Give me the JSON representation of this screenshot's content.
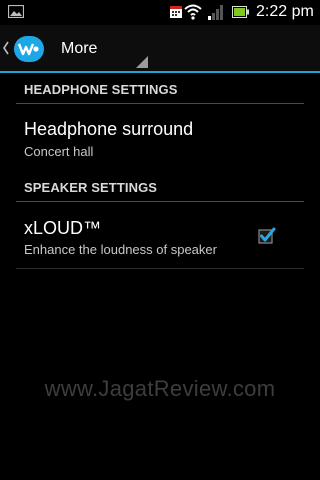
{
  "status_bar": {
    "time": "2:22 pm",
    "icons": [
      "gallery-icon",
      "calendar-notification-icon",
      "wifi-icon",
      "signal-icon",
      "battery-icon"
    ]
  },
  "action_bar": {
    "title": "More",
    "logo": "walkman-icon",
    "accent_color": "#1fa3d6"
  },
  "sections": [
    {
      "header": "HEADPHONE SETTINGS",
      "items": [
        {
          "title": "Headphone surround",
          "summary": "Concert hall"
        }
      ]
    },
    {
      "header": "SPEAKER SETTINGS",
      "items": [
        {
          "title": "xLOUD™",
          "summary": "Enhance the loudness of speaker",
          "checked": true
        }
      ]
    }
  ],
  "watermark": "www.JagatReview.com"
}
